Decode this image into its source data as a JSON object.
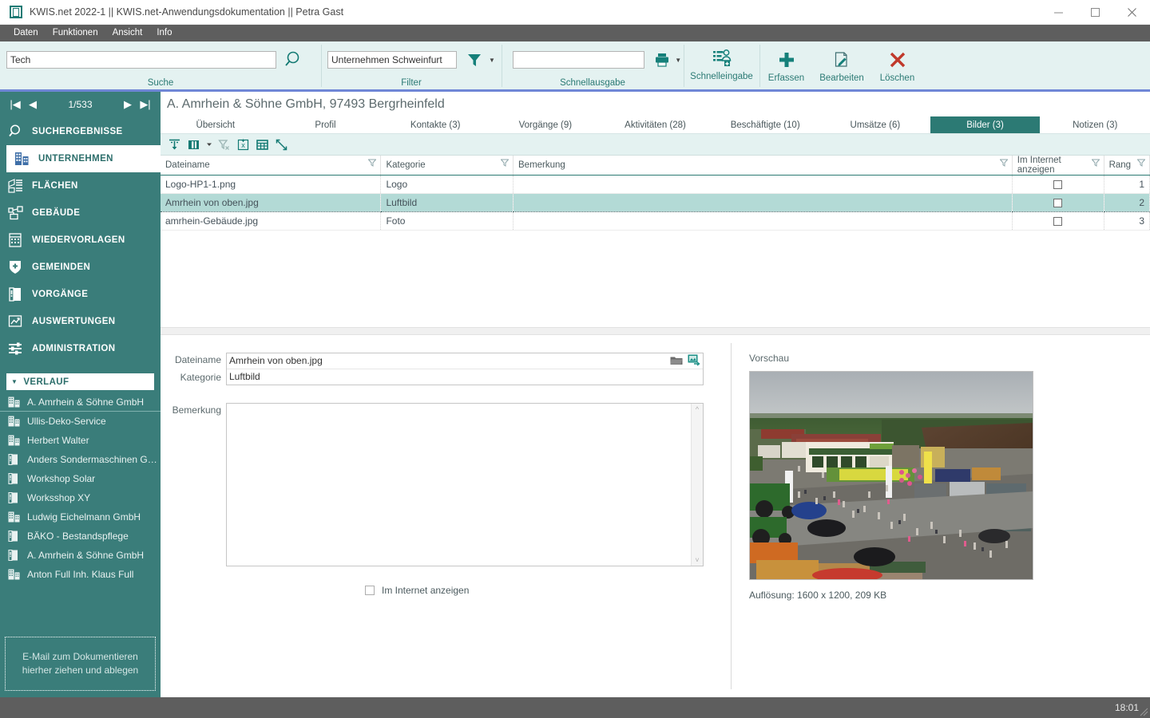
{
  "window": {
    "title": "KWIS.net 2022-1 || KWIS.net-Anwendungsdokumentation || Petra Gast",
    "app_icon": "app-window-icon",
    "minimize": "minimize-icon",
    "maximize": "maximize-icon",
    "close": "close-icon"
  },
  "menubar": {
    "items": [
      "Daten",
      "Funktionen",
      "Ansicht",
      "Info"
    ]
  },
  "ribbon": {
    "suche": {
      "label": "Suche",
      "value": "Tech",
      "placeholder": "",
      "icon": "search-icon"
    },
    "filter": {
      "label": "Filter",
      "value": "Unternehmen Schweinfurt",
      "placeholder": "",
      "icon": "funnel-icon",
      "caret": "▾"
    },
    "schnellausgabe": {
      "label": "Schnellausgabe",
      "value": "",
      "placeholder": "",
      "icon": "printer-icon",
      "caret": "▾"
    },
    "schnelleingabe": {
      "label": "Schnelleingabe",
      "icon": "quick-entry-icon"
    },
    "actions": [
      {
        "label": "Erfassen",
        "icon": "plus-icon"
      },
      {
        "label": "Bearbeiten",
        "icon": "edit-pencil-icon"
      },
      {
        "label": "Löschen",
        "icon": "x-delete-icon"
      }
    ]
  },
  "sidebar": {
    "pager": {
      "first": "|◀",
      "prev": "◀",
      "position": "1/533",
      "next": "▶",
      "last": "▶|"
    },
    "nav": [
      {
        "label": "SUCHERGEBNISSE",
        "icon": "magnifier-icon",
        "active": false
      },
      {
        "label": "UNTERNEHMEN",
        "icon": "company-building-icon",
        "active": true
      },
      {
        "label": "FLÄCHEN",
        "icon": "land-parcel-icon",
        "active": false
      },
      {
        "label": "GEBÄUDE",
        "icon": "buildings-icon",
        "active": false
      },
      {
        "label": "WIEDERVORLAGEN",
        "icon": "calendar-resubmission-icon",
        "active": false
      },
      {
        "label": "GEMEINDEN",
        "icon": "shield-icon",
        "active": false
      },
      {
        "label": "VORGÄNGE",
        "icon": "binder-icon",
        "active": false
      },
      {
        "label": "AUSWERTUNGEN",
        "icon": "chart-report-icon",
        "active": false
      },
      {
        "label": "ADMINISTRATION",
        "icon": "sliders-icon",
        "active": false
      }
    ],
    "verlauf": {
      "title": "VERLAUF",
      "expander": "▼",
      "items": [
        {
          "label": "A. Amrhein & Söhne GmbH",
          "icon": "company-building-icon"
        },
        {
          "label": "Ullis-Deko-Service",
          "icon": "company-building-icon"
        },
        {
          "label": "Herbert Walter",
          "icon": "company-building-icon"
        },
        {
          "label": "Anders  Sondermaschinen  Gmb...",
          "icon": "binder-icon"
        },
        {
          "label": "Workshop Solar",
          "icon": "binder-icon"
        },
        {
          "label": "Worksshop XY",
          "icon": "binder-icon"
        },
        {
          "label": "Ludwig Eichelmann GmbH",
          "icon": "company-building-icon"
        },
        {
          "label": "BÄKO - Bestandspflege",
          "icon": "binder-icon"
        },
        {
          "label": "A. Amrhein & Söhne GmbH",
          "icon": "binder-icon"
        },
        {
          "label": "Anton Full Inh. Klaus Full",
          "icon": "company-building-icon"
        }
      ]
    },
    "dropzone": {
      "line1": "E-Mail  zum Dokumentieren",
      "line2": "hierher ziehen und ablegen"
    }
  },
  "record": {
    "title": "A. Amrhein & Söhne GmbH, 97493 Bergrheinfeld",
    "tabs": [
      {
        "label": "Übersicht",
        "active": false,
        "accel": "b"
      },
      {
        "label": "Profil",
        "active": false
      },
      {
        "label": "Kontakte (3)",
        "active": false
      },
      {
        "label": "Vorgänge (9)",
        "active": false
      },
      {
        "label": "Aktivitäten (28)",
        "active": false
      },
      {
        "label": "Beschäftigte (10)",
        "active": false
      },
      {
        "label": "Umsätze (6)",
        "active": false
      },
      {
        "label": "Bilder (3)",
        "active": true
      },
      {
        "label": "Notizen (3)",
        "active": false
      }
    ]
  },
  "gridtools": [
    {
      "icon": "sort-column-icon",
      "name": "auto-fit-icon",
      "disabled": false
    },
    {
      "icon": "column-chooser-icon",
      "name": "columns-icon",
      "disabled": false
    },
    {
      "icon": "caret-down-icon",
      "name": "columns-dropdown-icon",
      "disabled": false
    },
    {
      "icon": "clear-grouping-icon",
      "name": "remove-filter-icon",
      "disabled": true
    },
    {
      "icon": "excel-export-icon",
      "name": "export-excel-icon",
      "disabled": false
    },
    {
      "icon": "table-layout-icon",
      "name": "table-view-icon",
      "disabled": false
    },
    {
      "icon": "expand-icon",
      "name": "fullscreen-icon",
      "disabled": false
    }
  ],
  "table": {
    "columns": [
      {
        "label": "Dateiname",
        "filter": true
      },
      {
        "label": "Kategorie",
        "filter": true
      },
      {
        "label": "Bemerkung",
        "filter": true
      },
      {
        "label": "Im Internet anzeigen",
        "filter": true
      },
      {
        "label": "Rang",
        "filter": true
      }
    ],
    "rows": [
      {
        "dateiname": "Logo-HP1-1.png",
        "kategorie": "Logo",
        "bemerkung": "",
        "internet": false,
        "rang": "1",
        "selected": false
      },
      {
        "dateiname": "Amrhein von oben.jpg",
        "kategorie": "Luftbild",
        "bemerkung": "",
        "internet": false,
        "rang": "2",
        "selected": true
      },
      {
        "dateiname": "amrhein-Gebäude.jpg",
        "kategorie": "Foto",
        "bemerkung": "",
        "internet": false,
        "rang": "3",
        "selected": false
      }
    ]
  },
  "detail": {
    "dateiname_label": "Dateiname",
    "dateiname_value": "Amrhein von oben.jpg",
    "kategorie_label": "Kategorie",
    "kategorie_value": "Luftbild",
    "bemerkung_label": "Bemerkung",
    "bemerkung_value": "",
    "internet_checkbox_label": "Im Internet anzeigen",
    "internet_checked": false,
    "folder_icon": "folder-open-icon",
    "image_export_icon": "image-export-icon"
  },
  "preview": {
    "label": "Vorschau",
    "resolution": "Auflösung: 1600 x 1200, 209 KB",
    "alt": "aerial-photo-of-farm-machinery-fair"
  },
  "statusbar": {
    "time": "18:01"
  },
  "colors": {
    "accent_teal": "#2c7a74",
    "sidebar_teal": "#3a7d7a",
    "ribbon_bg": "#e4f2f1",
    "menu_gray": "#5e5e5e",
    "ribbon_underline": "#6f86d6",
    "row_selected": "#b3dad6",
    "delete_red": "#c0392b"
  }
}
